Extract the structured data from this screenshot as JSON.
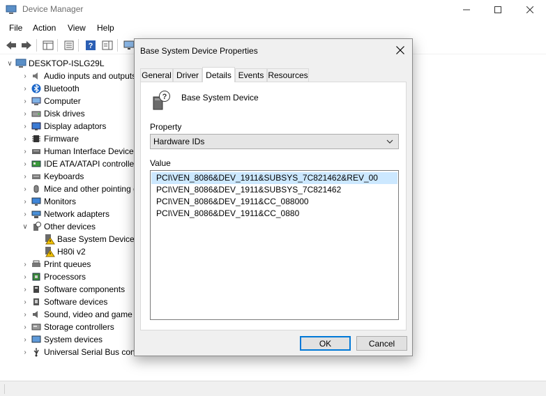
{
  "window": {
    "title": "Device Manager"
  },
  "menu": {
    "items": [
      "File",
      "Action",
      "View",
      "Help"
    ]
  },
  "tree": {
    "root": "DESKTOP-ISLG29L",
    "items": [
      {
        "label": "Audio inputs and outputs",
        "icon": "speaker-icon",
        "expanded": false
      },
      {
        "label": "Bluetooth",
        "icon": "bluetooth-icon",
        "expanded": false
      },
      {
        "label": "Computer",
        "icon": "computer-icon",
        "expanded": false
      },
      {
        "label": "Disk drives",
        "icon": "disk-drive-icon",
        "expanded": false
      },
      {
        "label": "Display adaptors",
        "icon": "display-adapter-icon",
        "expanded": false
      },
      {
        "label": "Firmware",
        "icon": "firmware-icon",
        "expanded": false
      },
      {
        "label": "Human Interface Devices",
        "icon": "hid-icon",
        "expanded": false
      },
      {
        "label": "IDE ATA/ATAPI controllers",
        "icon": "ide-controller-icon",
        "expanded": false
      },
      {
        "label": "Keyboards",
        "icon": "keyboard-icon",
        "expanded": false
      },
      {
        "label": "Mice and other pointing devices",
        "icon": "mouse-icon",
        "expanded": false
      },
      {
        "label": "Monitors",
        "icon": "monitor-icon",
        "expanded": false
      },
      {
        "label": "Network adapters",
        "icon": "network-adapter-icon",
        "expanded": false
      },
      {
        "label": "Other devices",
        "icon": "other-devices-icon",
        "expanded": true,
        "children": [
          {
            "label": "Base System Device",
            "icon": "warning-device-icon"
          },
          {
            "label": "H80i v2",
            "icon": "warning-device-icon"
          }
        ]
      },
      {
        "label": "Print queues",
        "icon": "printer-icon",
        "expanded": false
      },
      {
        "label": "Processors",
        "icon": "processor-icon",
        "expanded": false
      },
      {
        "label": "Software components",
        "icon": "software-component-icon",
        "expanded": false
      },
      {
        "label": "Software devices",
        "icon": "software-device-icon",
        "expanded": false
      },
      {
        "label": "Sound, video and game controllers",
        "icon": "sound-icon",
        "expanded": false
      },
      {
        "label": "Storage controllers",
        "icon": "storage-controller-icon",
        "expanded": false
      },
      {
        "label": "System devices",
        "icon": "system-devices-icon",
        "expanded": false
      },
      {
        "label": "Universal Serial Bus controllers",
        "icon": "usb-icon",
        "expanded": false
      }
    ]
  },
  "dialog": {
    "title": "Base System Device Properties",
    "tabs": [
      "General",
      "Driver",
      "Details",
      "Events",
      "Resources"
    ],
    "active_tab": "Details",
    "device_name": "Base System Device",
    "property_label": "Property",
    "property_value": "Hardware IDs",
    "value_label": "Value",
    "values": [
      "PCI\\VEN_8086&DEV_1911&SUBSYS_7C821462&REV_00",
      "PCI\\VEN_8086&DEV_1911&SUBSYS_7C821462",
      "PCI\\VEN_8086&DEV_1911&CC_088000",
      "PCI\\VEN_8086&DEV_1911&CC_0880"
    ],
    "ok_label": "OK",
    "cancel_label": "Cancel"
  }
}
